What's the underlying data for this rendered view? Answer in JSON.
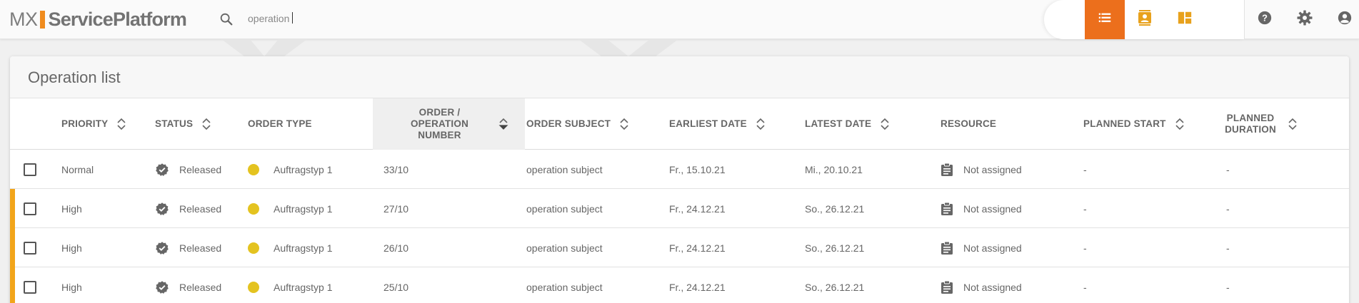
{
  "app": {
    "logo_prefix": "MX",
    "logo_name": "ServicePlatform",
    "brand_color": "#f08c1e"
  },
  "search": {
    "value": "operation",
    "placeholder": "",
    "icon": "search-icon"
  },
  "view_switch": [
    {
      "name": "list-view",
      "icon": "list-icon",
      "active": true
    },
    {
      "name": "contact-view",
      "icon": "contact-card-icon",
      "active": false
    },
    {
      "name": "dashboard-view",
      "icon": "dashboard-icon",
      "active": false
    }
  ],
  "toolbar": [
    {
      "name": "help-button",
      "icon": "help-icon"
    },
    {
      "name": "settings-button",
      "icon": "gear-icon"
    },
    {
      "name": "account-button",
      "icon": "account-icon"
    }
  ],
  "colors": {
    "accent": "#ec6f1c",
    "high_priority": "#f2a51a",
    "order_type_dot": "#e4c320"
  },
  "page": {
    "title": "Operation list"
  },
  "table": {
    "columns": [
      {
        "key": "priority",
        "label": "PRIORITY",
        "sortable": true
      },
      {
        "key": "status",
        "label": "STATUS",
        "sortable": true
      },
      {
        "key": "order_type",
        "label": "ORDER TYPE",
        "sortable": false
      },
      {
        "key": "number",
        "label": "ORDER / OPERATION NUMBER",
        "sortable": true,
        "sorted": true
      },
      {
        "key": "subject",
        "label": "ORDER SUBJECT",
        "sortable": true
      },
      {
        "key": "earliest",
        "label": "EARLIEST DATE",
        "sortable": true
      },
      {
        "key": "latest",
        "label": "LATEST DATE",
        "sortable": true
      },
      {
        "key": "resource",
        "label": "RESOURCE",
        "sortable": false
      },
      {
        "key": "planned_start",
        "label": "PLANNED START",
        "sortable": true
      },
      {
        "key": "planned_duration",
        "label": "PLANNED DURATION",
        "sortable": true
      }
    ],
    "rows": [
      {
        "priority": "Normal",
        "high": false,
        "status": "Released",
        "order_type": "Auftragstyp 1",
        "number": "33/10",
        "subject": "operation subject",
        "earliest": "Fr., 15.10.21",
        "latest": "Mi., 20.10.21",
        "resource": "Not assigned",
        "planned_start": "-",
        "planned_duration": "-"
      },
      {
        "priority": "High",
        "high": true,
        "status": "Released",
        "order_type": "Auftragstyp 1",
        "number": "27/10",
        "subject": "operation subject",
        "earliest": "Fr., 24.12.21",
        "latest": "So., 26.12.21",
        "resource": "Not assigned",
        "planned_start": "-",
        "planned_duration": "-"
      },
      {
        "priority": "High",
        "high": true,
        "status": "Released",
        "order_type": "Auftragstyp 1",
        "number": "26/10",
        "subject": "operation subject",
        "earliest": "Fr., 24.12.21",
        "latest": "So., 26.12.21",
        "resource": "Not assigned",
        "planned_start": "-",
        "planned_duration": "-"
      },
      {
        "priority": "High",
        "high": true,
        "status": "Released",
        "order_type": "Auftragstyp 1",
        "number": "25/10",
        "subject": "operation subject",
        "earliest": "Fr., 24.12.21",
        "latest": "So., 26.12.21",
        "resource": "Not assigned",
        "planned_start": "-",
        "planned_duration": "-"
      }
    ]
  }
}
